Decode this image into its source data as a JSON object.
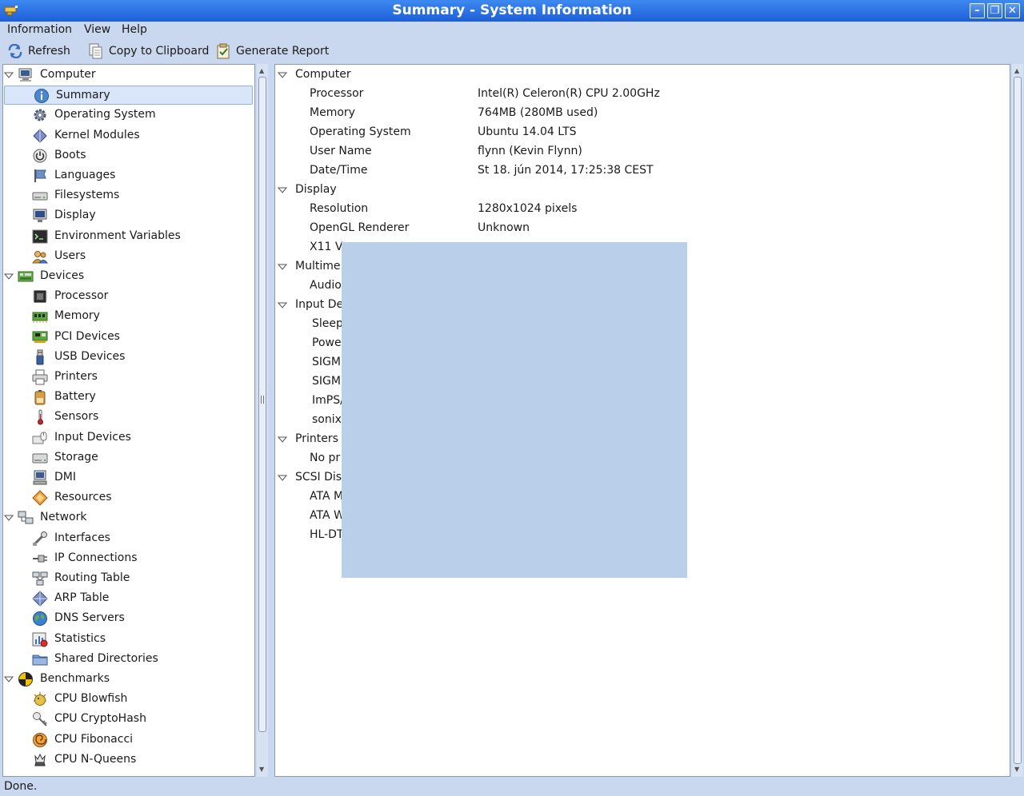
{
  "window": {
    "title": "Summary - System Information"
  },
  "menubar": {
    "information": "Information",
    "view": "View",
    "help": "Help"
  },
  "toolbar": {
    "refresh": "Refresh",
    "copy": "Copy to Clipboard",
    "report": "Generate Report"
  },
  "tree": [
    {
      "label": "Computer",
      "level": 0,
      "icon": "computer-icon",
      "expanded": true
    },
    {
      "label": "Summary",
      "level": 1,
      "icon": "info-icon",
      "selected": true
    },
    {
      "label": "Operating System",
      "level": 1,
      "icon": "gear-icon"
    },
    {
      "label": "Kernel Modules",
      "level": 1,
      "icon": "module-icon"
    },
    {
      "label": "Boots",
      "level": 1,
      "icon": "power-icon"
    },
    {
      "label": "Languages",
      "level": 1,
      "icon": "flag-icon"
    },
    {
      "label": "Filesystems",
      "level": 1,
      "icon": "drive-icon"
    },
    {
      "label": "Display",
      "level": 1,
      "icon": "monitor-icon"
    },
    {
      "label": "Environment Variables",
      "level": 1,
      "icon": "terminal-icon"
    },
    {
      "label": "Users",
      "level": 1,
      "icon": "users-icon"
    },
    {
      "label": "Devices",
      "level": 0,
      "icon": "board-icon",
      "expanded": true
    },
    {
      "label": "Processor",
      "level": 1,
      "icon": "chip-icon"
    },
    {
      "label": "Memory",
      "level": 1,
      "icon": "ram-icon"
    },
    {
      "label": "PCI Devices",
      "level": 1,
      "icon": "pci-icon"
    },
    {
      "label": "USB Devices",
      "level": 1,
      "icon": "usb-icon"
    },
    {
      "label": "Printers",
      "level": 1,
      "icon": "printer-icon"
    },
    {
      "label": "Battery",
      "level": 1,
      "icon": "battery-icon"
    },
    {
      "label": "Sensors",
      "level": 1,
      "icon": "thermometer-icon"
    },
    {
      "label": "Input Devices",
      "level": 1,
      "icon": "input-icon"
    },
    {
      "label": "Storage",
      "level": 1,
      "icon": "storage-icon"
    },
    {
      "label": "DMI",
      "level": 1,
      "icon": "dmi-icon"
    },
    {
      "label": "Resources",
      "level": 1,
      "icon": "resources-icon"
    },
    {
      "label": "Network",
      "level": 0,
      "icon": "network-icon",
      "expanded": true
    },
    {
      "label": "Interfaces",
      "level": 1,
      "icon": "interfaces-icon"
    },
    {
      "label": "IP Connections",
      "level": 1,
      "icon": "plug-icon"
    },
    {
      "label": "Routing Table",
      "level": 1,
      "icon": "routing-icon"
    },
    {
      "label": "ARP Table",
      "level": 1,
      "icon": "arp-icon"
    },
    {
      "label": "DNS Servers",
      "level": 1,
      "icon": "globe-icon"
    },
    {
      "label": "Statistics",
      "level": 1,
      "icon": "statistics-icon"
    },
    {
      "label": "Shared Directories",
      "level": 1,
      "icon": "folder-icon"
    },
    {
      "label": "Benchmarks",
      "level": 0,
      "icon": "benchmark-icon",
      "expanded": true
    },
    {
      "label": "CPU Blowfish",
      "level": 1,
      "icon": "blowfish-icon"
    },
    {
      "label": "CPU CryptoHash",
      "level": 1,
      "icon": "cryptohash-icon"
    },
    {
      "label": "CPU Fibonacci",
      "level": 1,
      "icon": "fibonacci-icon"
    },
    {
      "label": "CPU N-Queens",
      "level": 1,
      "icon": "nqueens-icon"
    }
  ],
  "details": [
    {
      "type": "section",
      "label": "Computer"
    },
    {
      "type": "item",
      "key": "Processor",
      "value": "Intel(R) Celeron(R) CPU 2.00GHz"
    },
    {
      "type": "item",
      "key": "Memory",
      "value": "764MB (280MB used)"
    },
    {
      "type": "item",
      "key": "Operating System",
      "value": "Ubuntu 14.04 LTS"
    },
    {
      "type": "item",
      "key": "User Name",
      "value": "flynn (Kevin Flynn)"
    },
    {
      "type": "item",
      "key": "Date/Time",
      "value": "St 18. jún 2014, 17:25:38 CEST"
    },
    {
      "type": "section",
      "label": "Display"
    },
    {
      "type": "item",
      "key": "Resolution",
      "value": "1280x1024 pixels"
    },
    {
      "type": "item",
      "key": "OpenGL Renderer",
      "value": "Unknown"
    },
    {
      "type": "item",
      "key": "X11 Ve",
      "value": ""
    },
    {
      "type": "section",
      "label": "Multime"
    },
    {
      "type": "item",
      "key": "Audio",
      "value": ""
    },
    {
      "type": "section",
      "label": "Input De"
    },
    {
      "type": "item",
      "key": "Sleep",
      "value": "",
      "indent": "deep"
    },
    {
      "type": "item",
      "key": "Powe",
      "value": "",
      "indent": "deep"
    },
    {
      "type": "item",
      "key": "SIGM.",
      "value": "",
      "indent": "deep"
    },
    {
      "type": "item",
      "key": "SIGM.",
      "value": "",
      "indent": "deep"
    },
    {
      "type": "item",
      "key": "ImPS/",
      "value": "",
      "indent": "deep"
    },
    {
      "type": "item",
      "key": "sonix",
      "value": "",
      "indent": "deep"
    },
    {
      "type": "section",
      "label": "Printers"
    },
    {
      "type": "item",
      "key": "No pr",
      "value": ""
    },
    {
      "type": "section",
      "label": "SCSI Disk"
    },
    {
      "type": "item",
      "key": "ATA M",
      "value": ""
    },
    {
      "type": "item",
      "key": "ATA W",
      "value": ""
    },
    {
      "type": "item",
      "key": "HL-DT",
      "value": ""
    }
  ],
  "status": {
    "text": "Done."
  },
  "colors": {
    "titlebar": "#1c5fd8",
    "chrome": "#c9d8ee",
    "selection": "#d9e6f9",
    "overlay": "#b9cfea"
  }
}
